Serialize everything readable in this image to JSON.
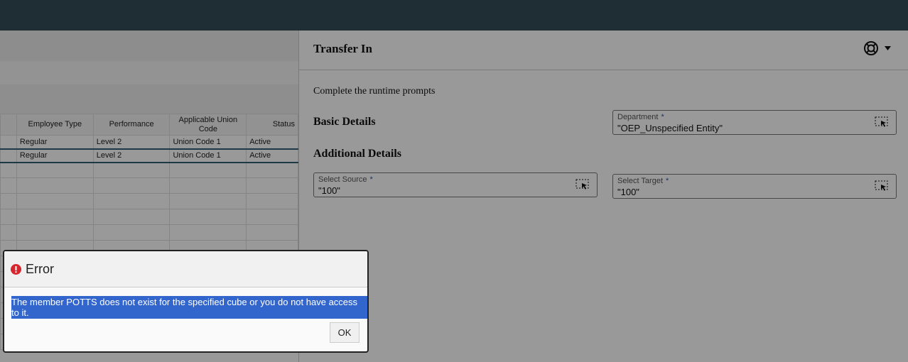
{
  "grid": {
    "headers": [
      "",
      "Employee Type",
      "Performance",
      "Applicable Union Code",
      "Status"
    ],
    "rows": [
      [
        "",
        "Regular",
        "Level 2",
        "Union Code 1",
        "Active"
      ],
      [
        "",
        "Regular",
        "Level 2",
        "Union Code 1",
        "Active"
      ]
    ]
  },
  "panel": {
    "title": "Transfer In",
    "subtitle": "Complete the runtime prompts",
    "basic": "Basic Details",
    "additional": "Additional Details",
    "department": {
      "label": "Department",
      "value": "\"OEP_Unspecified Entity\""
    },
    "source": {
      "label": "Select Source",
      "value": "\"100\""
    },
    "target": {
      "label": "Select Target",
      "value": "\"100\""
    },
    "required_mark": "*"
  },
  "dialog": {
    "title": "Error",
    "message": "The member POTTS does not exist for the specified cube or you do not have access to it.",
    "ok_label": "OK"
  }
}
